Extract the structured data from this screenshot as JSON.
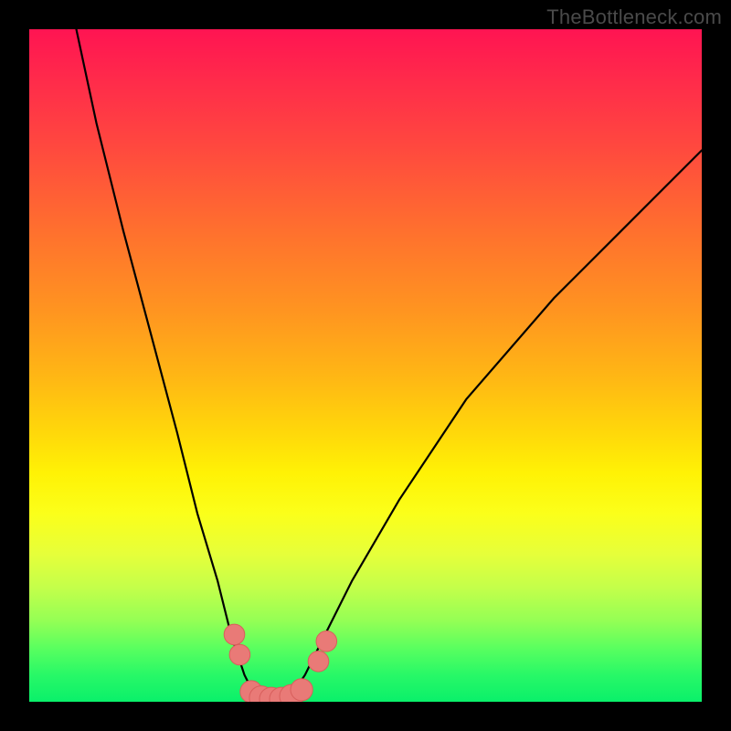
{
  "watermark": "TheBottleneck.com",
  "chart_data": {
    "type": "line",
    "title": "",
    "xlabel": "",
    "ylabel": "",
    "xlim": [
      0,
      100
    ],
    "ylim": [
      0,
      100
    ],
    "grid": false,
    "legend": false,
    "series": [
      {
        "name": "bottleneck-curve",
        "x": [
          7,
          10,
          14,
          18,
          22,
          25,
          28,
          30,
          32,
          33.5,
          35,
          37,
          39,
          41,
          44,
          48,
          55,
          65,
          78,
          92,
          100
        ],
        "values": [
          100,
          86,
          70,
          55,
          40,
          28,
          18,
          10,
          4,
          1,
          0,
          0,
          1,
          4,
          10,
          18,
          30,
          45,
          60,
          74,
          82
        ]
      }
    ],
    "markers": [
      {
        "x": 30.5,
        "y": 10,
        "r": 1.4
      },
      {
        "x": 31.3,
        "y": 7,
        "r": 1.4
      },
      {
        "x": 33.0,
        "y": 1.5,
        "r": 1.5
      },
      {
        "x": 34.5,
        "y": 0.6,
        "r": 1.6
      },
      {
        "x": 36.0,
        "y": 0.4,
        "r": 1.6
      },
      {
        "x": 37.5,
        "y": 0.4,
        "r": 1.6
      },
      {
        "x": 39.0,
        "y": 0.8,
        "r": 1.6
      },
      {
        "x": 40.5,
        "y": 1.8,
        "r": 1.5
      },
      {
        "x": 43.0,
        "y": 6,
        "r": 1.4
      },
      {
        "x": 44.2,
        "y": 9,
        "r": 1.4
      }
    ],
    "colors": {
      "curve": "#000000",
      "marker_fill": "#e97a77",
      "marker_stroke": "#d85f5c"
    }
  }
}
